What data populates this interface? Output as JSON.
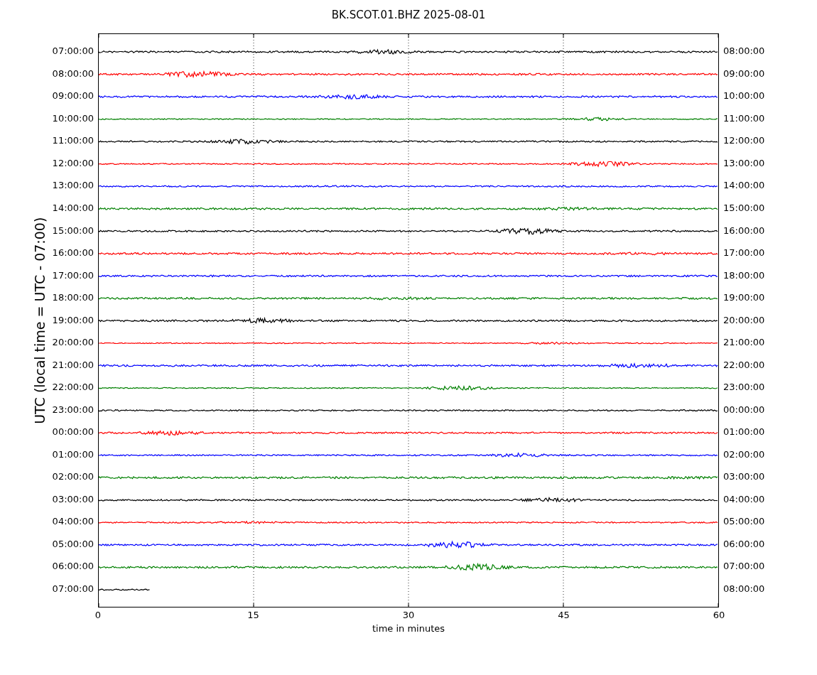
{
  "title": "BK.SCOT.01.BHZ 2025-08-01",
  "ylabel": "UTC (local time = UTC - 07:00)",
  "xlabel": "time in minutes",
  "xticks": [
    "0",
    "15",
    "30",
    "45",
    "60"
  ],
  "traces": [
    {
      "left": "07:00:00",
      "right": "08:00:00",
      "color": "#000000",
      "level": 1
    },
    {
      "left": "08:00:00",
      "right": "09:00:00",
      "color": "#ff0000",
      "level": 1
    },
    {
      "left": "09:00:00",
      "right": "10:00:00",
      "color": "#0000ff",
      "level": 1
    },
    {
      "left": "10:00:00",
      "right": "11:00:00",
      "color": "#008000",
      "level": 1
    },
    {
      "left": "11:00:00",
      "right": "12:00:00",
      "color": "#000000",
      "level": 1
    },
    {
      "left": "12:00:00",
      "right": "13:00:00",
      "color": "#ff0000",
      "level": 1
    },
    {
      "left": "13:00:00",
      "right": "14:00:00",
      "color": "#0000ff",
      "level": 1
    },
    {
      "left": "14:00:00",
      "right": "15:00:00",
      "color": "#008000",
      "level": 1
    },
    {
      "left": "15:00:00",
      "right": "16:00:00",
      "color": "#000000",
      "level": 1
    },
    {
      "left": "16:00:00",
      "right": "17:00:00",
      "color": "#ff0000",
      "level": 1
    },
    {
      "left": "17:00:00",
      "right": "18:00:00",
      "color": "#0000ff",
      "level": 1
    },
    {
      "left": "18:00:00",
      "right": "19:00:00",
      "color": "#008000",
      "level": 1
    },
    {
      "left": "19:00:00",
      "right": "20:00:00",
      "color": "#000000",
      "level": 1
    },
    {
      "left": "20:00:00",
      "right": "21:00:00",
      "color": "#ff0000",
      "level": 1
    },
    {
      "left": "21:00:00",
      "right": "22:00:00",
      "color": "#0000ff",
      "level": 1
    },
    {
      "left": "22:00:00",
      "right": "23:00:00",
      "color": "#008000",
      "level": 1
    },
    {
      "left": "23:00:00",
      "right": "00:00:00",
      "color": "#000000",
      "level": 1
    },
    {
      "left": "00:00:00",
      "right": "01:00:00",
      "color": "#ff0000",
      "level": 1
    },
    {
      "left": "01:00:00",
      "right": "02:00:00",
      "color": "#0000ff",
      "level": 1
    },
    {
      "left": "02:00:00",
      "right": "03:00:00",
      "color": "#008000",
      "level": 1
    },
    {
      "left": "03:00:00",
      "right": "04:00:00",
      "color": "#000000",
      "level": 1
    },
    {
      "left": "04:00:00",
      "right": "05:00:00",
      "color": "#ff0000",
      "level": 1
    },
    {
      "left": "05:00:00",
      "right": "06:00:00",
      "color": "#0000ff",
      "level": 1
    },
    {
      "left": "06:00:00",
      "right": "07:00:00",
      "color": "#008000",
      "level": 1
    },
    {
      "left": "07:00:00",
      "right": "08:00:00",
      "color": "#000000",
      "level": 0.083
    }
  ]
}
